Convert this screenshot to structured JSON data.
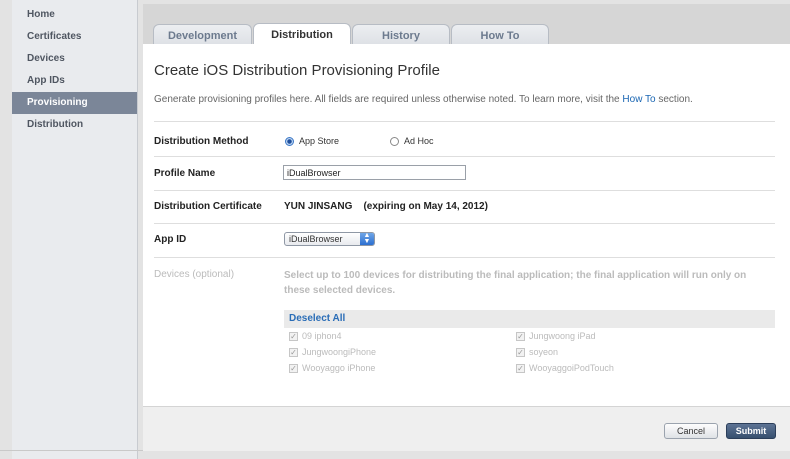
{
  "sidebar": {
    "items": [
      {
        "label": "Home"
      },
      {
        "label": "Certificates"
      },
      {
        "label": "Devices"
      },
      {
        "label": "App IDs"
      },
      {
        "label": "Provisioning",
        "active": true
      },
      {
        "label": "Distribution"
      }
    ]
  },
  "tabs": [
    {
      "label": "Development"
    },
    {
      "label": "Distribution",
      "active": true
    },
    {
      "label": "History"
    },
    {
      "label": "How To"
    }
  ],
  "main": {
    "title": "Create iOS Distribution Provisioning Profile",
    "intro_text": "Generate provisioning profiles here. All fields are required unless otherwise noted. To learn more, visit the",
    "intro_link": "How To",
    "intro_suffix": "section."
  },
  "form": {
    "method_label": "Distribution Method",
    "method_options": [
      {
        "label": "App Store",
        "selected": true
      },
      {
        "label": "Ad Hoc",
        "selected": false
      }
    ],
    "profile_name_label": "Profile Name",
    "profile_name_value": "iDualBrowser",
    "certificate_label": "Distribution Certificate",
    "certificate_value": "YUN JINSANG    (expiring on May 14, 2012)",
    "app_id_label": "App ID",
    "app_id_value": "iDualBrowser",
    "devices_label": "Devices (optional)",
    "devices_help": "Select up to 100 devices for distributing the final application; the final application will run only on these selected devices.",
    "deselect_all": "Deselect All",
    "devices": [
      {
        "name": "09 iphon4",
        "checked": true
      },
      {
        "name": "Jungwoong iPad",
        "checked": true
      },
      {
        "name": "JungwoongiPhone",
        "checked": true
      },
      {
        "name": "soyeon",
        "checked": true
      },
      {
        "name": "Wooyaggo iPhone",
        "checked": true
      },
      {
        "name": "WooyaggoiPodTouch",
        "checked": true
      }
    ]
  },
  "footer": {
    "cancel_label": "Cancel",
    "submit_label": "Submit"
  },
  "colors": {
    "sidebar_active": "#7b8698",
    "link": "#1a66b3",
    "submit": "#37506f"
  }
}
